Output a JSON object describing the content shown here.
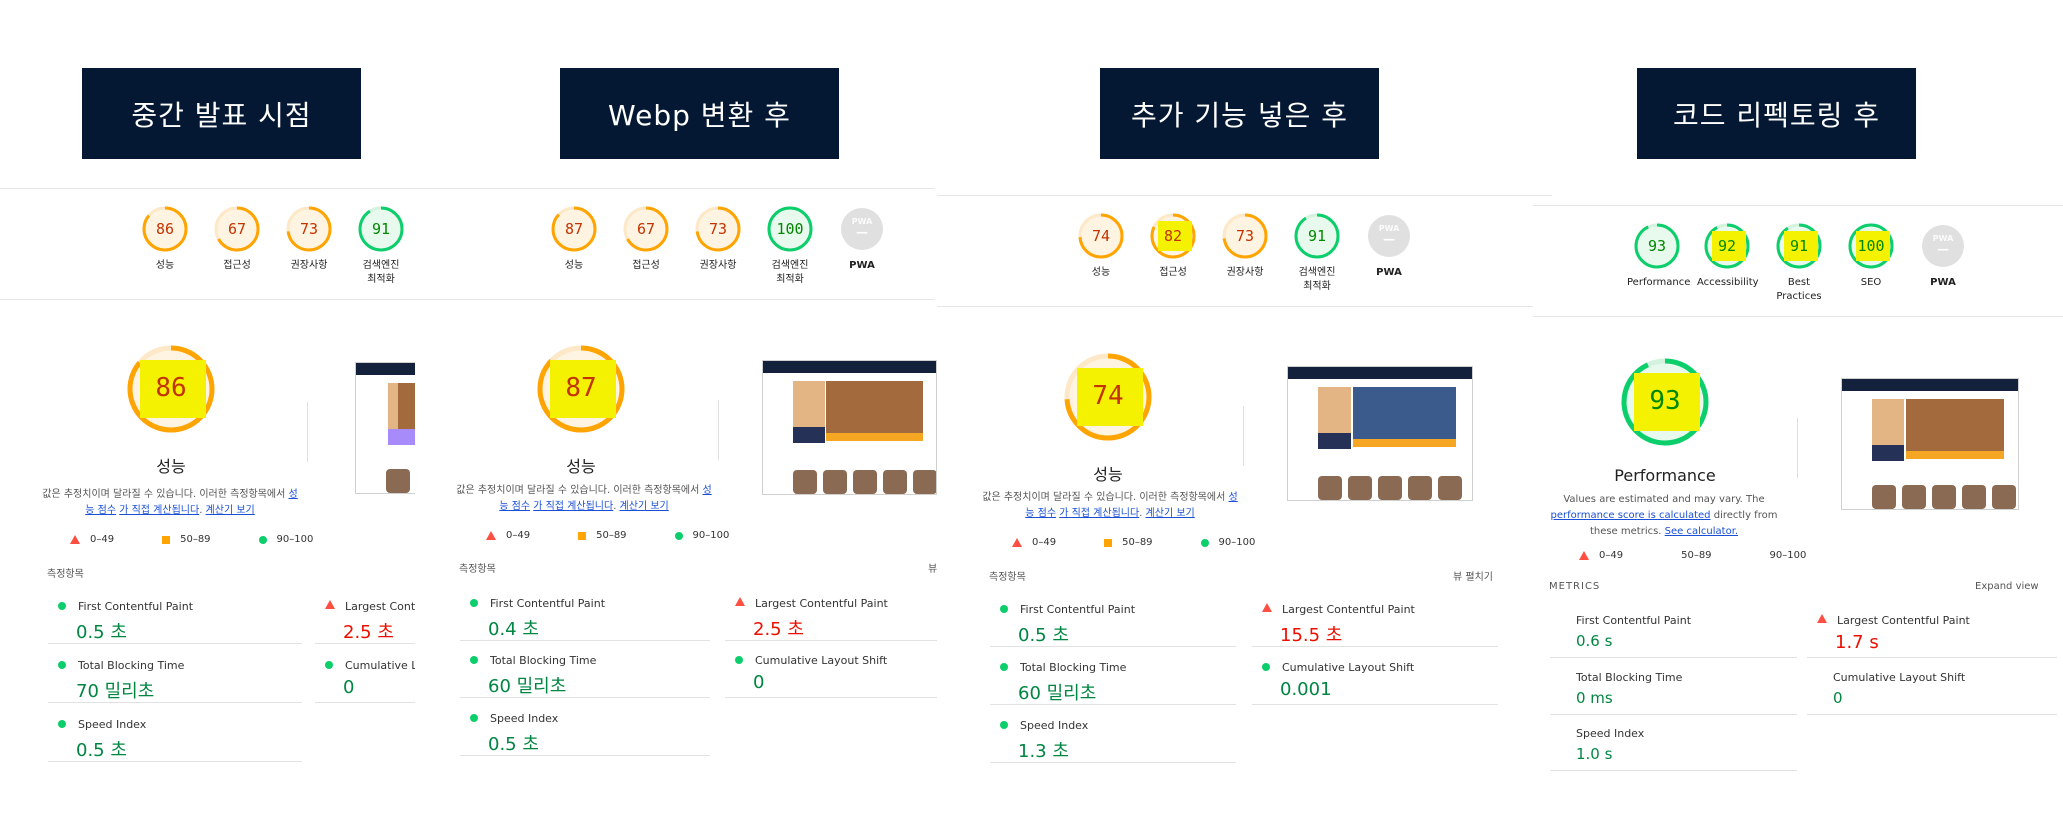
{
  "panels": [
    {
      "title": "중간 발표 시점",
      "summary": [
        {
          "score": "86",
          "label": "성능",
          "color": "#ffa400"
        },
        {
          "score": "67",
          "label": "접근성",
          "color": "#ffa400"
        },
        {
          "score": "73",
          "label": "권장사항",
          "color": "#ffa400"
        },
        {
          "score": "91",
          "label": "검색엔진\n최적화",
          "color": "#0cce6b"
        }
      ],
      "main_score": "86",
      "main_label": "성능",
      "desc_plain": "값은 추정치이며 달라질 수 있습니다. 이러한 측정항목에서 ",
      "desc_link1": "성능 점수",
      "desc_link2": "가 직접 계산됩니다",
      "desc_link3": "계산기 보기",
      "legend": [
        "0–49",
        "50–89",
        "90–100"
      ],
      "section": "측정항목",
      "metrics": [
        {
          "name": "First Contentful Paint",
          "value": "0.5 초",
          "status": "good"
        },
        {
          "name": "Largest Contentful Paint",
          "value": "2.5 초",
          "status": "bad"
        },
        {
          "name": "Total Blocking Time",
          "value": "70 밀리초",
          "status": "good"
        },
        {
          "name": "Cumulative Layout Shift",
          "value": "0",
          "status": "good"
        },
        {
          "name": "Speed Index",
          "value": "0.5 초",
          "status": "good"
        }
      ]
    },
    {
      "title": "Webp 변환 후",
      "summary": [
        {
          "score": "87",
          "label": "성능",
          "color": "#ffa400"
        },
        {
          "score": "67",
          "label": "접근성",
          "color": "#ffa400"
        },
        {
          "score": "73",
          "label": "권장사항",
          "color": "#ffa400"
        },
        {
          "score": "100",
          "label": "검색엔진\n최적화",
          "color": "#0cce6b"
        },
        {
          "score": "PWA",
          "label": "PWA",
          "color": "#cccccc"
        }
      ],
      "main_score": "87",
      "main_label": "성능",
      "desc_plain": "값은 추정치이며 달라질 수 있습니다. 이러한 측정항목에서 ",
      "desc_link1": "성능 점수",
      "desc_link2": "가 직접 계산됩니다",
      "desc_link3": "계산기 보기",
      "legend": [
        "0–49",
        "50–89",
        "90–100"
      ],
      "section": "측정항목",
      "section_right": "뷰",
      "metrics": [
        {
          "name": "First Contentful Paint",
          "value": "0.4 초",
          "status": "good"
        },
        {
          "name": "Largest Contentful Paint",
          "value": "2.5 초",
          "status": "bad"
        },
        {
          "name": "Total Blocking Time",
          "value": "60 밀리초",
          "status": "good"
        },
        {
          "name": "Cumulative Layout Shift",
          "value": "0",
          "status": "good"
        },
        {
          "name": "Speed Index",
          "value": "0.5 초",
          "status": "good"
        }
      ]
    },
    {
      "title": "추가 기능 넣은 후",
      "summary": [
        {
          "score": "74",
          "label": "성능",
          "color": "#ffa400"
        },
        {
          "score": "82",
          "label": "접근성",
          "color": "#ffa400"
        },
        {
          "score": "73",
          "label": "권장사항",
          "color": "#ffa400"
        },
        {
          "score": "91",
          "label": "검색엔진\n최적화",
          "color": "#0cce6b"
        },
        {
          "score": "PWA",
          "label": "PWA",
          "color": "#cccccc"
        }
      ],
      "main_score": "74",
      "main_label": "성능",
      "desc_plain": "값은 추정치이며 달라질 수 있습니다. 이러한 측정항목에서 ",
      "desc_link1": "성능 점수",
      "desc_link2": "가 직접 계산됩니다",
      "desc_link3": "계산기 보기",
      "legend": [
        "0–49",
        "50–89",
        "90–100"
      ],
      "section": "측정항목",
      "section_right": "뷰 펼치기",
      "metrics": [
        {
          "name": "First Contentful Paint",
          "value": "0.5 초",
          "status": "good"
        },
        {
          "name": "Largest Contentful Paint",
          "value": "15.5 초",
          "status": "bad"
        },
        {
          "name": "Total Blocking Time",
          "value": "60 밀리초",
          "status": "good"
        },
        {
          "name": "Cumulative Layout Shift",
          "value": "0.001",
          "status": "good"
        },
        {
          "name": "Speed Index",
          "value": "1.3 초",
          "status": "good"
        }
      ]
    },
    {
      "title": "코드 리펙토링 후",
      "summary": [
        {
          "score": "93",
          "label": "Performance",
          "color": "#0cce6b"
        },
        {
          "score": "92",
          "label": "Accessibility",
          "color": "#0cce6b"
        },
        {
          "score": "91",
          "label": "Best\nPractices",
          "color": "#0cce6b"
        },
        {
          "score": "100",
          "label": "SEO",
          "color": "#0cce6b"
        },
        {
          "score": "PWA",
          "label": "PWA",
          "color": "#cccccc"
        }
      ],
      "main_score": "93",
      "main_label": "Performance",
      "desc_plain": "Values are estimated and may vary. The ",
      "desc_link1": "performance score is calculated",
      "desc_link2": "directly from these metrics.",
      "desc_link3": "See calculator.",
      "legend": [
        "0–49",
        "50–89",
        "90–100"
      ],
      "section": "METRICS",
      "section_right": "Expand view",
      "metrics": [
        {
          "name": "First Contentful Paint",
          "value": "0.6 s",
          "status": "neutral"
        },
        {
          "name": "Largest Contentful Paint",
          "value": "1.7 s",
          "status": "bad"
        },
        {
          "name": "Total Blocking Time",
          "value": "0 ms",
          "status": "neutral"
        },
        {
          "name": "Cumulative Layout Shift",
          "value": "0",
          "status": "neutral"
        },
        {
          "name": "Speed Index",
          "value": "1.0 s",
          "status": "neutral"
        }
      ]
    }
  ],
  "colors": {
    "good": "#0cce6b",
    "average": "#ffa400",
    "poor": "#ff4e42",
    "highlight": "#f4f200",
    "title_bg": "#041833"
  }
}
